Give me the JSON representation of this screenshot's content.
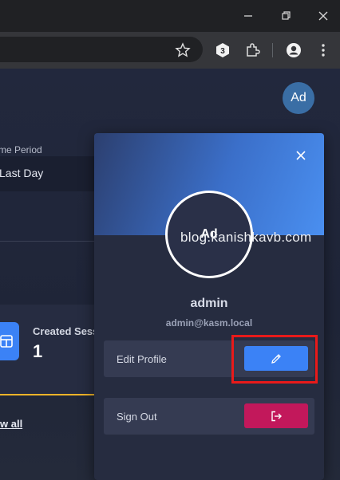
{
  "browser": {
    "icons": [
      "minimize-icon",
      "restore-icon",
      "close-icon",
      "star-icon",
      "extension-3-icon",
      "puzzle-icon",
      "profile-icon",
      "more-icon"
    ]
  },
  "header": {
    "avatar_initials": "Ad"
  },
  "filters": {
    "time_period_label": "me Period",
    "time_period_value": "Last Day"
  },
  "stats": {
    "created_sessions_label": "Created Sess",
    "created_sessions_value": "1",
    "view_all": "w all"
  },
  "profile_popup": {
    "avatar_initials": "Ad",
    "username": "admin",
    "email": "admin@kasm.local",
    "edit_profile_label": "Edit Profile",
    "sign_out_label": "Sign Out"
  },
  "colors": {
    "primary": "#3b82f6",
    "danger": "#c2185b",
    "highlight": "#e81a1a",
    "accent": "#f0b429"
  },
  "watermark": "blog.kanishkavb.com"
}
